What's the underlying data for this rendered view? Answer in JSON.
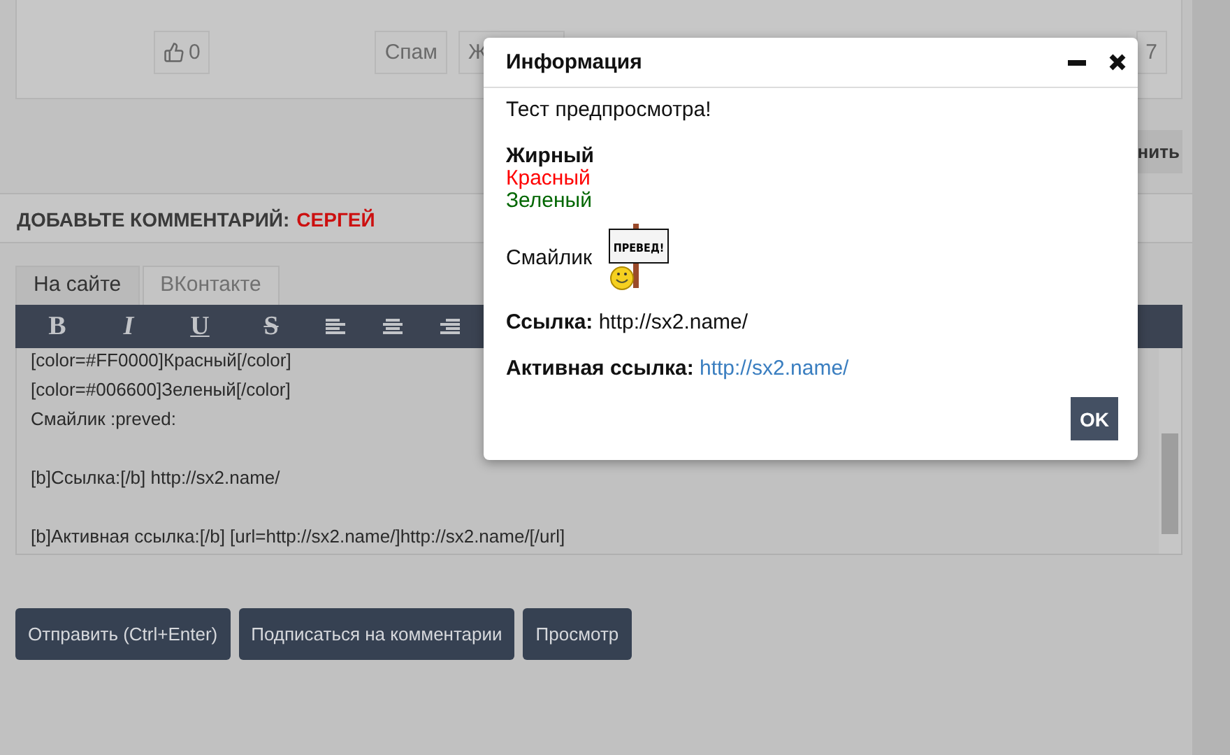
{
  "comment_card": {
    "like_count": "0",
    "buttons": [
      "Спам",
      "Ж",
      "7"
    ]
  },
  "side_button": "нить",
  "comment_form": {
    "title": "ДОБАВЬТЕ КОММЕНТАРИЙ:",
    "user": "СЕРГЕЙ",
    "tabs": [
      {
        "label": "На сайте",
        "selected": true
      },
      {
        "label": "ВКонтакте",
        "selected": false
      }
    ],
    "toolbar": [
      {
        "kind": "bold",
        "label": "B"
      },
      {
        "kind": "italic",
        "label": "I"
      },
      {
        "kind": "underline",
        "label": "U"
      },
      {
        "kind": "strike",
        "label": "S"
      },
      {
        "kind": "align-left"
      },
      {
        "kind": "align-center"
      },
      {
        "kind": "align-right"
      }
    ],
    "editor_paragraphs": [
      [
        "[color=#FF0000]Красный[/color]",
        "[color=#006600]Зеленый[/color]",
        "Смайлик  :preved:"
      ],
      [
        "[b]Ссылка:[/b] http://sx2.name/"
      ],
      [
        "[b]Активная ссылка:[/b] [url=http://sx2.name/]http://sx2.name/[/url]"
      ]
    ],
    "buttons": [
      "Отправить (Ctrl+Enter)",
      "Подписаться на комментарии",
      "Просмотр"
    ]
  },
  "dialog": {
    "title": "Информация",
    "intro": "Тест предпросмотра!",
    "styled_lines": [
      {
        "text": "Жирный",
        "kind": "bold"
      },
      {
        "text": "Красный",
        "kind": "colored",
        "color": "#ff0000"
      },
      {
        "text": "Зеленый",
        "kind": "colored",
        "color": "#006600"
      }
    ],
    "smiley_label": "Смайлик",
    "smiley_sign": "ПРЕВЕД!",
    "link_label": "Ссылка:",
    "link_text": "http://sx2.name/",
    "active_link_label": "Активная ссылка:",
    "active_link": "http://sx2.name/",
    "ok_button": "OK"
  }
}
